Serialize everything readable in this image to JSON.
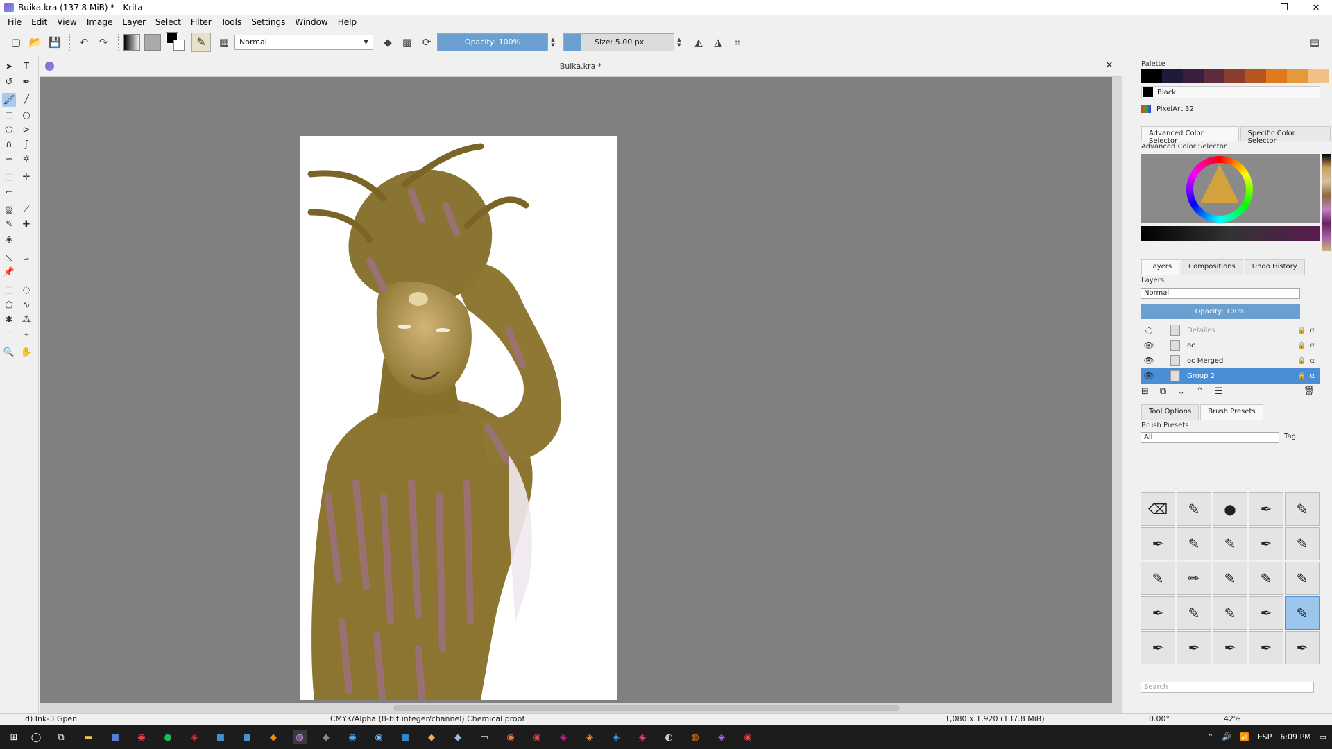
{
  "window": {
    "title": "Buika.kra (137.8 MiB)  * - Krita",
    "minimize": "—",
    "maximize": "❐",
    "close": "✕"
  },
  "menu": [
    "File",
    "Edit",
    "View",
    "Image",
    "Layer",
    "Select",
    "Filter",
    "Tools",
    "Settings",
    "Window",
    "Help"
  ],
  "toolbar": {
    "blend_mode": "Normal",
    "opacity_label": "Opacity: 100%",
    "size_label": "Size: 5.00 px"
  },
  "document": {
    "tab_title": "Buika.kra *",
    "close": "✕"
  },
  "palette": {
    "title": "Palette",
    "colors": [
      "#000000",
      "#1f1a3a",
      "#3a1e3d",
      "#5e2c3c",
      "#8a3e2f",
      "#b4561f",
      "#e07a1c",
      "#e29a3c",
      "#f0c087"
    ],
    "current_color_name": "Black",
    "palette_name": "PixelArt 32"
  },
  "color_selector": {
    "tabs": [
      "Advanced Color Selector",
      "Specific Color Selector"
    ],
    "title": "Advanced Color Selector"
  },
  "layers": {
    "tabs": [
      "Layers",
      "Compositions",
      "Undo History"
    ],
    "title": "Layers",
    "blend_mode": "Normal",
    "opacity_label": "Opacity:  100%",
    "items": [
      {
        "name": "Detalles",
        "visible": false
      },
      {
        "name": "oc",
        "visible": true
      },
      {
        "name": "oc Merged",
        "visible": true
      },
      {
        "name": "Group 2",
        "visible": true,
        "selected": true
      }
    ]
  },
  "brush_presets": {
    "tabs": [
      "Tool Options",
      "Brush Presets"
    ],
    "title": "Brush Presets",
    "filter": "All",
    "tag_label": "Tag",
    "search_placeholder": "Search"
  },
  "statusbar": {
    "brush_name": "d) Ink-3 Gpen",
    "color_info": "CMYK/Alpha (8-bit integer/channel)  Chemical proof",
    "image_size": "1,080 x 1,920 (137.8 MiB)",
    "rotation": "0.00°",
    "zoom": "42%"
  },
  "taskbar": {
    "language": "ESP",
    "time": "6:09 PM"
  },
  "colors": {
    "accent": "#6a9fd0",
    "canvas_bg": "#808080",
    "ochre": "#8b7530",
    "mauve": "#a0708a"
  }
}
